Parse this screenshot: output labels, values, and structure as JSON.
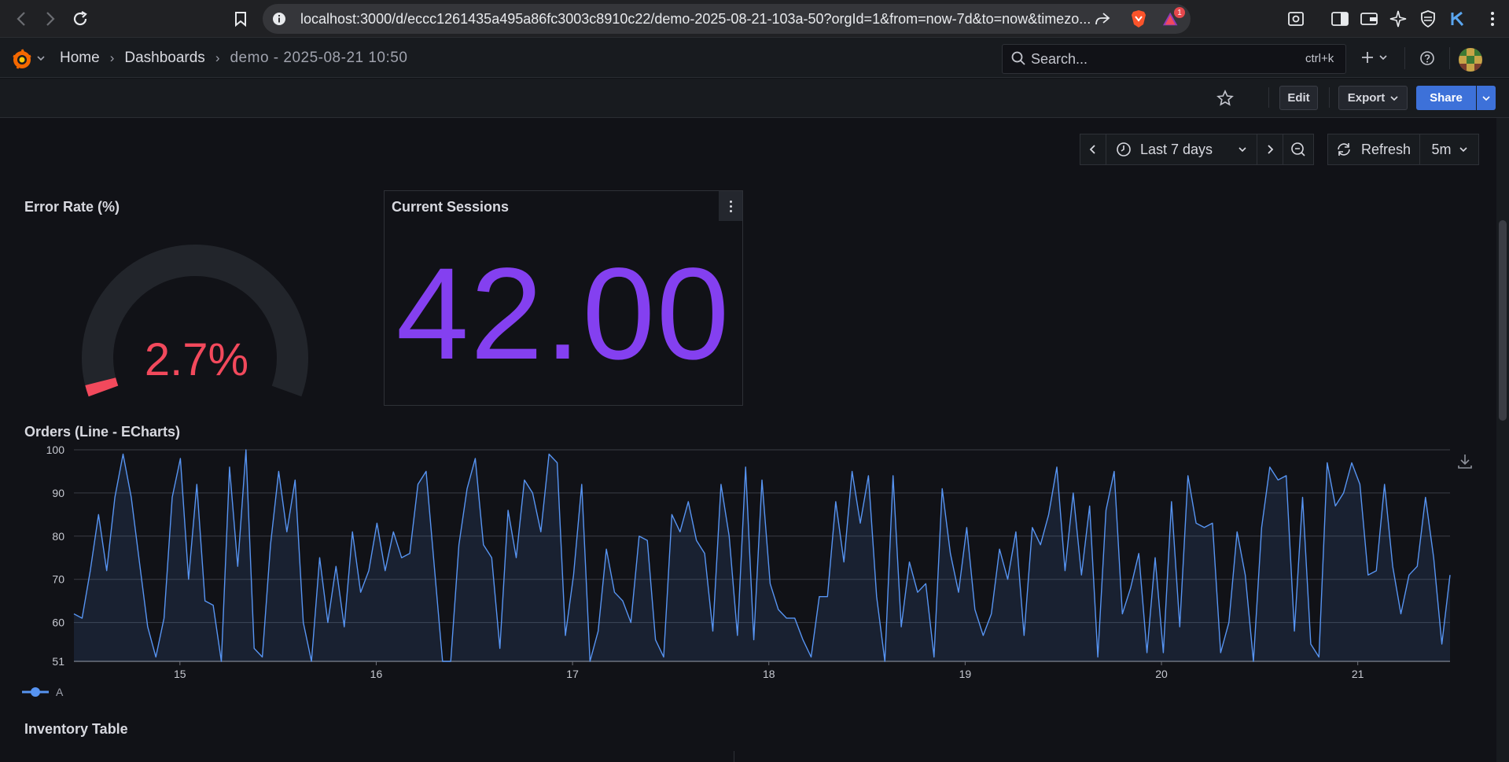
{
  "browser": {
    "url_host": "localhost",
    "url_rest": ":3000/d/eccc1261435a495a86fc3003c8910c22/demo-2025-08-21-103a-50?orgId=1&from=now-7d&to=now&timezo...",
    "notification_count": "1"
  },
  "grafana": {
    "breadcrumb": [
      "Home",
      "Dashboards",
      "demo - 2025-08-21 10:50"
    ],
    "search_placeholder": "Search...",
    "search_shortcut": "ctrl+k"
  },
  "toolbar": {
    "edit_label": "Edit",
    "export_label": "Export",
    "share_label": "Share"
  },
  "time_controls": {
    "range_label": "Last 7 days",
    "refresh_label": "Refresh",
    "interval_label": "5m"
  },
  "panels": {
    "error_rate": {
      "title": "Error Rate (%)",
      "value": 2.7,
      "display": "2.7%",
      "max": 100,
      "color": "#f2495c"
    },
    "sessions": {
      "title": "Current Sessions",
      "value": "42.00",
      "color": "#8f3bb8"
    },
    "orders": {
      "title": "Orders (Line - ECharts)",
      "legend_name": "A"
    },
    "inventory": {
      "title": "Inventory Table"
    }
  },
  "chart_data": {
    "type": "area",
    "title": "Orders (Line - ECharts)",
    "ylim": [
      51,
      100
    ],
    "yticks": [
      51,
      60,
      70,
      80,
      90,
      100
    ],
    "x_range": [
      14.46,
      21.47
    ],
    "xticks": [
      15,
      16,
      17,
      18,
      19,
      20,
      21
    ],
    "color": "#5794f2",
    "series": [
      {
        "name": "A",
        "values": [
          62,
          61,
          72,
          85,
          72,
          89,
          99,
          89,
          74,
          59,
          52,
          61,
          89,
          98,
          70,
          92,
          65,
          64,
          51,
          96,
          73,
          100,
          54,
          52,
          78,
          95,
          81,
          93,
          60,
          51,
          75,
          60,
          73,
          59,
          81,
          67,
          72,
          83,
          72,
          81,
          75,
          76,
          92,
          95,
          73,
          51,
          51,
          78,
          91,
          98,
          78,
          75,
          54,
          86,
          75,
          93,
          90,
          81,
          99,
          97,
          57,
          71,
          92,
          51,
          58,
          77,
          67,
          65,
          60,
          80,
          79,
          56,
          52,
          85,
          81,
          88,
          79,
          76,
          58,
          92,
          80,
          57,
          96,
          56,
          93,
          69,
          63,
          61,
          61,
          56,
          52,
          66,
          66,
          88,
          74,
          95,
          83,
          94,
          66,
          51,
          94,
          59,
          74,
          67,
          69,
          52,
          91,
          76,
          67,
          82,
          63,
          57,
          62,
          77,
          70,
          81,
          57,
          82,
          78,
          85,
          96,
          72,
          90,
          71,
          87,
          52,
          86,
          95,
          62,
          68,
          76,
          53,
          75,
          53,
          88,
          59,
          94,
          83,
          82,
          83,
          53,
          60,
          81,
          71,
          51,
          82,
          96,
          93,
          94,
          58,
          89,
          55,
          52,
          97,
          87,
          90,
          97,
          92,
          71,
          72,
          92,
          73,
          62,
          71,
          73,
          89,
          75,
          55,
          71
        ]
      }
    ]
  }
}
